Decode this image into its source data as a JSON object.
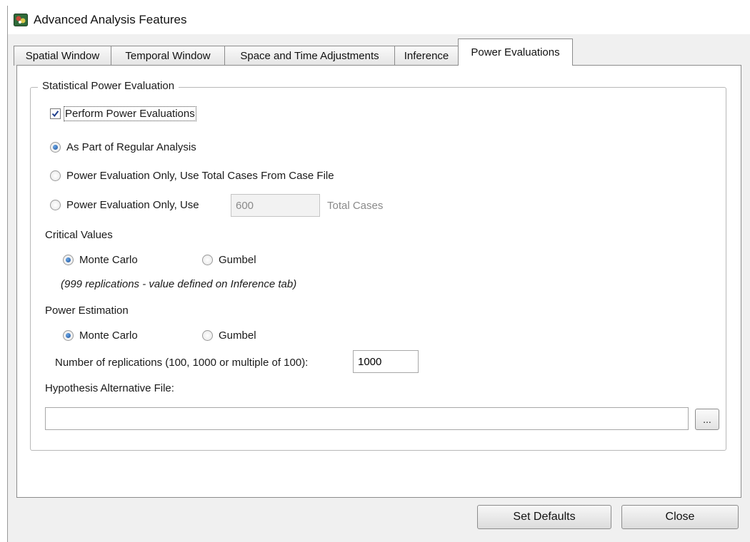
{
  "window": {
    "title": "Advanced Analysis Features",
    "icon": "app-logo-icon"
  },
  "tabs": [
    {
      "label": "Spatial Window",
      "active": false
    },
    {
      "label": "Temporal Window",
      "active": false
    },
    {
      "label": "Space and Time Adjustments",
      "active": false
    },
    {
      "label": "Inference",
      "active": false
    },
    {
      "label": "Power Evaluations",
      "active": true
    }
  ],
  "group": {
    "legend": "Statistical Power Evaluation",
    "perform_checkbox": {
      "label": "Perform Power Evaluations",
      "checked": true
    },
    "mode_options": [
      {
        "label": "As Part of Regular Analysis",
        "selected": true
      },
      {
        "label": "Power Evaluation Only, Use Total Cases From Case File",
        "selected": false
      },
      {
        "label": "Power Evaluation Only, Use",
        "selected": false
      }
    ],
    "total_cases_value": "600",
    "total_cases_suffix": "Total Cases",
    "critical_values": {
      "heading": "Critical Values",
      "options": [
        {
          "label": "Monte Carlo",
          "selected": true
        },
        {
          "label": "Gumbel",
          "selected": false
        }
      ],
      "note": "(999 replications - value defined on Inference tab)"
    },
    "power_estimation": {
      "heading": "Power Estimation",
      "options": [
        {
          "label": "Monte Carlo",
          "selected": true
        },
        {
          "label": "Gumbel",
          "selected": false
        }
      ],
      "replications_label": "Number of replications (100, 1000 or multiple of 100):",
      "replications_value": "1000"
    },
    "hypothesis_file": {
      "label": "Hypothesis Alternative File:",
      "value": "",
      "browse_label": "..."
    }
  },
  "buttons": {
    "set_defaults": "Set Defaults",
    "close": "Close"
  },
  "colors": {
    "accent": "#1d4f9a",
    "window_bg": "#f0f0f0",
    "panel_bg": "#ffffff"
  }
}
